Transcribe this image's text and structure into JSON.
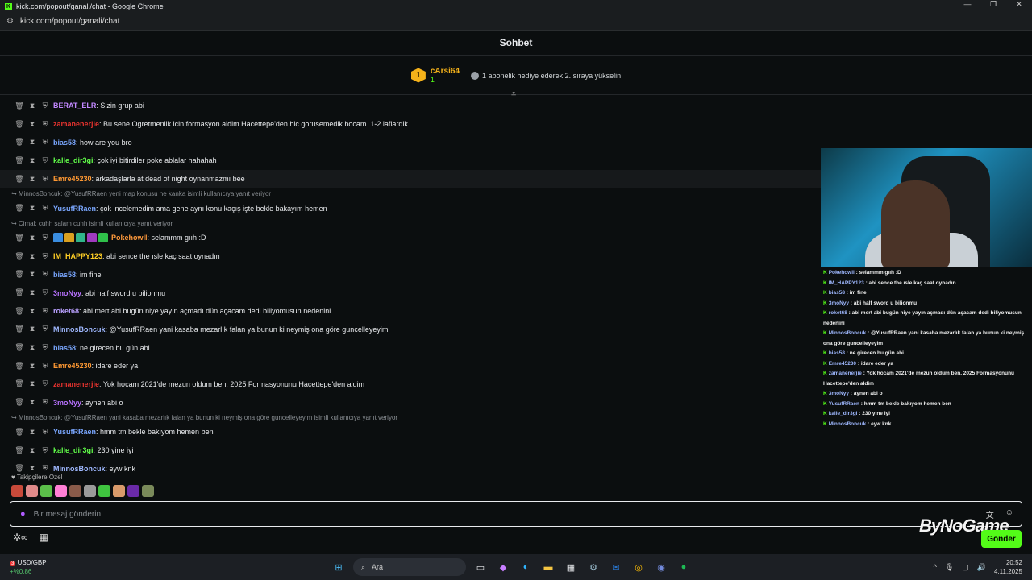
{
  "window": {
    "title": "kick.com/popout/ganali/chat - Google Chrome",
    "url": "kick.com/popout/ganali/chat"
  },
  "chat": {
    "title": "Sohbet"
  },
  "pinned": {
    "rank": "1",
    "name": "cArsi64",
    "count": "1",
    "promo": "1 abonelik hediye ederek 2. sıraya yükselin"
  },
  "messages": [
    {
      "user": "BERAT_ELR",
      "color": "#c288ff",
      "text": ": Sizin grup abi"
    },
    {
      "user": "zamanenerjie",
      "color": "#e8332f",
      "text": ": Bu sene Ogretmenlik icin formasyon aldim Hacettepe'den hic gorusemedik hocam. 1-2 laflardik"
    },
    {
      "user": "bias58",
      "color": "#7aa7ff",
      "text": ": how are you bro"
    },
    {
      "user": "kalle_dir3gi",
      "color": "#62ff4a",
      "text": ": çok iyi bitirdiler poke ablalar hahahah"
    },
    {
      "user": "Emre45230",
      "color": "#ff9933",
      "text": ": arkadaşlarla at dead of night oynanmazmı bee",
      "hl": true
    },
    {
      "reply": "MinnosBoncuk: @YusufRRaen yeni map konusu ne kanka isimli kullanıcıya yanıt veriyor"
    },
    {
      "user": "YusufRRaen",
      "color": "#7aa7ff",
      "text": ": çok incelemedim ama gene aynı konu kaçış işte bekle bakayım hemen"
    },
    {
      "reply": "Cimal: cuhh salam cuhh isimli kullanıcıya yanıt veriyor"
    },
    {
      "user": "Pokehowll",
      "color": "#ff9a3c",
      "text": ": selammm gııh :D",
      "badges": true
    },
    {
      "user": "IM_HAPPY123",
      "color": "#ffcf26",
      "text": ": abi sence the ısle kaç saat oynadın"
    },
    {
      "user": "bias58",
      "color": "#7aa7ff",
      "text": ": im fine"
    },
    {
      "user": "3moNyy",
      "color": "#b872ff",
      "text": ": abi half sword u bilionmu"
    },
    {
      "user": "roket68",
      "color": "#b9a0ff",
      "text": ": abi mert abi bugün niye yayın açmadı dün açacam dedi biliyomusun nedenini"
    },
    {
      "user": "MinnosBoncuk",
      "color": "#9fb8ff",
      "text": ": @YusufRRaen yani kasaba mezarlık falan ya bunun ki neymiş ona göre guncelleyeyim"
    },
    {
      "user": "bias58",
      "color": "#7aa7ff",
      "text": ": ne girecen bu gün abi"
    },
    {
      "user": "Emre45230",
      "color": "#ff9933",
      "text": ": idare eder ya"
    },
    {
      "user": "zamanenerjie",
      "color": "#e8332f",
      "text": ": Yok hocam 2021'de mezun oldum ben. 2025 Formasyonunu Hacettepe'den aldim"
    },
    {
      "user": "3moNyy",
      "color": "#b872ff",
      "text": ": aynen abi o"
    },
    {
      "reply": "MinnosBoncuk: @YusufRRaen yani kasaba mezarlık falan ya bunun ki neymiş ona göre guncelleyeyim isimli kullanıcıya yanıt veriyor"
    },
    {
      "user": "YusufRRaen",
      "color": "#7aa7ff",
      "text": ": hmm tm bekle bakıyom hemen ben"
    },
    {
      "user": "kalle_dir3gi",
      "color": "#62ff4a",
      "text": ": 230 yine iyi"
    },
    {
      "user": "MinnosBoncuk",
      "color": "#9fb8ff",
      "text": ": eyw knk"
    }
  ],
  "follower_label": "Takipçilere Özel",
  "input": {
    "placeholder": "Bir mesaj gönderin"
  },
  "send_label": "Gönder",
  "watermark": "ByNoGame",
  "overlay": [
    {
      "user": "Pokehowll",
      "text": " : selammm gııh :D"
    },
    {
      "user": "IM_HAPPY123",
      "text": " : abi sence the ısle kaç saat oynadın"
    },
    {
      "user": "bias58",
      "text": " : im fine"
    },
    {
      "user": "3moNyy",
      "text": " : abi half sword u bilionmu"
    },
    {
      "user": "roket68",
      "text": " : abi mert abi bugün niye yayın açmadı dün açacam dedi biliyomusun nedenini"
    },
    {
      "user": "MinnosBoncuk",
      "text": " : @YusufRRaen yani kasaba mezarlık falan ya bunun ki neymiş ona göre guncelleyeyim"
    },
    {
      "user": "bias58",
      "text": " : ne girecen bu gün abi"
    },
    {
      "user": "Emre45230",
      "text": " : idare eder ya"
    },
    {
      "user": "zamanenerjie",
      "text": " : Yok hocam 2021'de mezun oldum ben. 2025 Formasyonunu Hacettepe'den aldim"
    },
    {
      "user": "3moNyy",
      "text": " : aynen abi o"
    },
    {
      "user": "YusufRRaen",
      "text": " : hmm tm bekle bakıyom hemen ben"
    },
    {
      "user": "kalle_dir3gi",
      "text": " : 230 yine iyi"
    },
    {
      "user": "MinnosBoncuk",
      "text": " : eyw knk"
    }
  ],
  "taskbar": {
    "ticker": "USD/GBP",
    "change": "+%0,86",
    "badge": "3",
    "search": "Ara",
    "time": "20:52",
    "date": "4.11.2025"
  }
}
